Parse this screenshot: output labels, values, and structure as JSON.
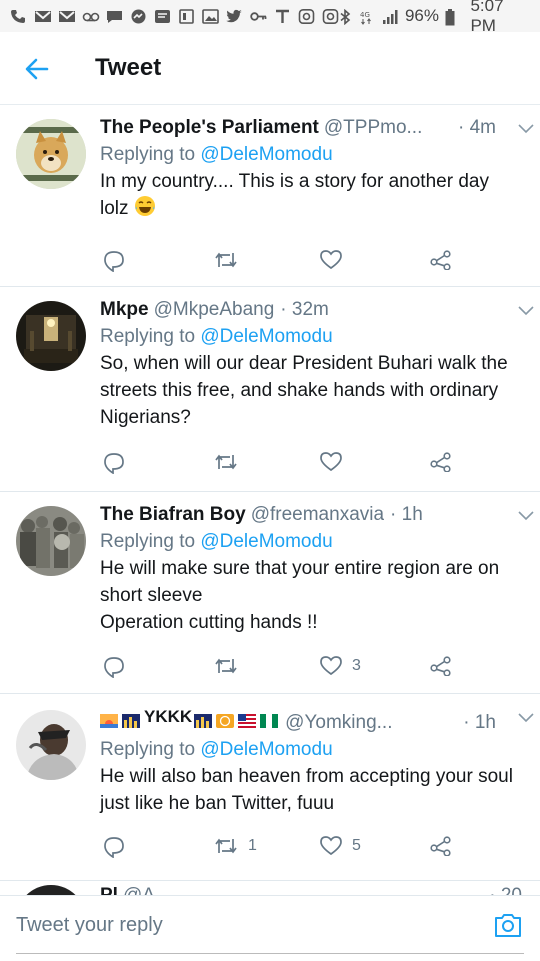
{
  "status_bar": {
    "battery": "96%",
    "time": "5:07 PM",
    "icons": [
      "phone-icon",
      "gmail-icon",
      "gmail-icon",
      "voicemail-icon",
      "chat-icon",
      "messenger-icon",
      "email-icon",
      "tablet-icon",
      "photo-icon",
      "twitter-icon",
      "key-icon",
      "t-icon",
      "instagram-icon",
      "instagram-icon",
      "bluetooth-icon",
      "4g-icon",
      "signal-icon",
      "battery-icon"
    ]
  },
  "header": {
    "title": "Tweet"
  },
  "tweets": [
    {
      "name": "The People's Parliament",
      "handle": "@TPPmo...",
      "time": "· 4m",
      "replying_prefix": "Replying to ",
      "replying_to": "@DeleMomodu",
      "text": "In my country.... This is a story for another day lolz",
      "emoji": "laughing-emoji",
      "likes": "",
      "retweets": ""
    },
    {
      "name": "Mkpe",
      "handle": "@MkpeAbang",
      "time": "· 32m",
      "replying_prefix": "Replying to ",
      "replying_to": "@DeleMomodu",
      "text": "So, when will our dear President Buhari walk the streets this free, and shake hands with ordinary Nigerians?",
      "likes": "",
      "retweets": ""
    },
    {
      "name": "The Biafran Boy",
      "handle": "@freemanxavia",
      "time": "· 1h",
      "replying_prefix": "Replying to ",
      "replying_to": "@DeleMomodu",
      "text_line1": "He will make sure that your entire region are on short sleeve",
      "text_line2": "Operation cutting hands !!",
      "likes": "3",
      "retweets": ""
    },
    {
      "name_text": "YKKK",
      "handle": "@Yomking...",
      "time": "· 1h",
      "replying_prefix": "Replying to ",
      "replying_to": "@DeleMomodu",
      "text": "He will also ban heaven from accepting your soul just like he ban Twitter, fuuu",
      "likes": "5",
      "retweets": "1"
    },
    {
      "name": "Pl",
      "handle": "@A",
      "time": "· 20"
    }
  ],
  "composer": {
    "placeholder": "Tweet your reply"
  },
  "colors": {
    "accent": "#1da1f2",
    "text": "#14171a",
    "muted": "#657786",
    "divider": "#e1e8ed"
  }
}
